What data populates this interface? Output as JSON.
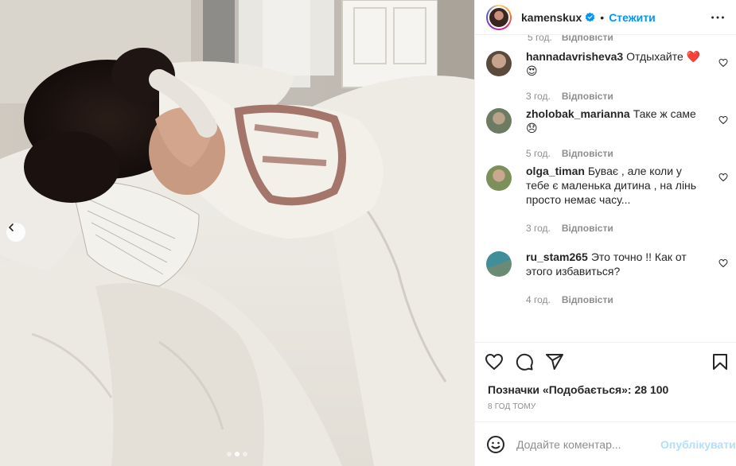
{
  "post": {
    "username": "kamenskux",
    "separator": "•",
    "follow_label": "Стежити",
    "more_icon": "more-horizontal-icon",
    "verified_icon": "verified-badge-icon"
  },
  "photo": {
    "alt_icon": "carousel-prev-icon",
    "dots_count": 3,
    "active_dot": 1
  },
  "top_partial_meta": {
    "time": "5 год.",
    "reply": "Відповісти"
  },
  "comments": [
    {
      "user": "hannadavrisheva3",
      "text": "Отдыхайте ❤️ 😍",
      "time": "3 год.",
      "reply": "Відповісти",
      "avatar_color": "#5a4a3e"
    },
    {
      "user": "zholobak_marianna",
      "text": "Таке ж саме😞",
      "time": "5 год.",
      "reply": "Відповісти",
      "avatar_color": "#6c7b62"
    },
    {
      "user": "olga_timan",
      "text": "Буває , але коли у тебе є маленька дитина , на лінь просто немає часу...",
      "time": "3 год.",
      "reply": "Відповісти",
      "avatar_color": "#7d8f5a"
    },
    {
      "user": "ru_stam265",
      "text": "Это точно !! Как от этого избавиться?",
      "time": "4 год.",
      "reply": "Відповісти",
      "avatar_color": "#3f8f9a"
    }
  ],
  "actions": {
    "like_icon": "heart-icon",
    "comment_icon": "comment-icon",
    "share_icon": "share-icon",
    "save_icon": "bookmark-icon"
  },
  "likes": {
    "label": "Позначки «Подобається»:",
    "count": "28 100"
  },
  "timestamp": "8 ГОД ТОМУ",
  "add_comment": {
    "placeholder": "Додайте коментар...",
    "publish_label": "Опублікувати",
    "emoji_icon": "emoji-icon"
  },
  "colors": {
    "accent": "#0095f6",
    "publish_disabled": "#b2dffc",
    "muted": "#8e8e8e",
    "text": "#262626"
  }
}
